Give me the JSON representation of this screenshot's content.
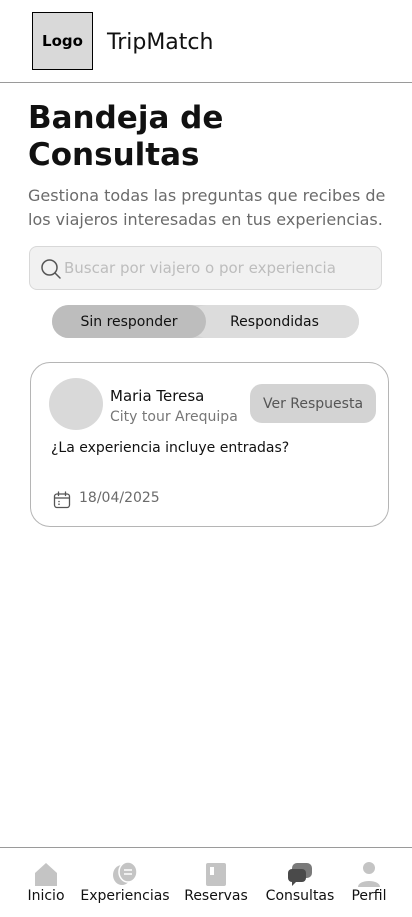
{
  "header": {
    "logo": "Logo",
    "brand": "TripMatch"
  },
  "page": {
    "title": "Bandeja de Consultas",
    "subtitle": "Gestiona todas las preguntas que recibes de los viajeros interesadas en tus experiencias."
  },
  "search": {
    "placeholder": "Buscar por viajero o por experiencia",
    "value": ""
  },
  "tabs": [
    {
      "label": "Sin responder",
      "active": true
    },
    {
      "label": "Respondidas",
      "active": false
    }
  ],
  "inquiries": [
    {
      "traveler": "Maria Teresa",
      "experience": "City tour Arequipa",
      "action_label": "Ver Respuesta",
      "question": "¿La experiencia incluye entradas?",
      "date": "18/04/2025"
    }
  ],
  "bottom_nav": [
    {
      "label": "Inicio",
      "icon": "home-icon",
      "active": false
    },
    {
      "label": "Experiencias",
      "icon": "masks-icon",
      "active": false
    },
    {
      "label": "Reservas",
      "icon": "book-icon",
      "active": false
    },
    {
      "label": "Consultas",
      "icon": "chat-icon",
      "active": true
    },
    {
      "label": "Perfil",
      "icon": "user-icon",
      "active": false
    }
  ],
  "colors": {
    "active_icon": "#5a5a5a",
    "inactive_icon": "#c4c4c4",
    "accent_gray": "#d3d3d3"
  }
}
